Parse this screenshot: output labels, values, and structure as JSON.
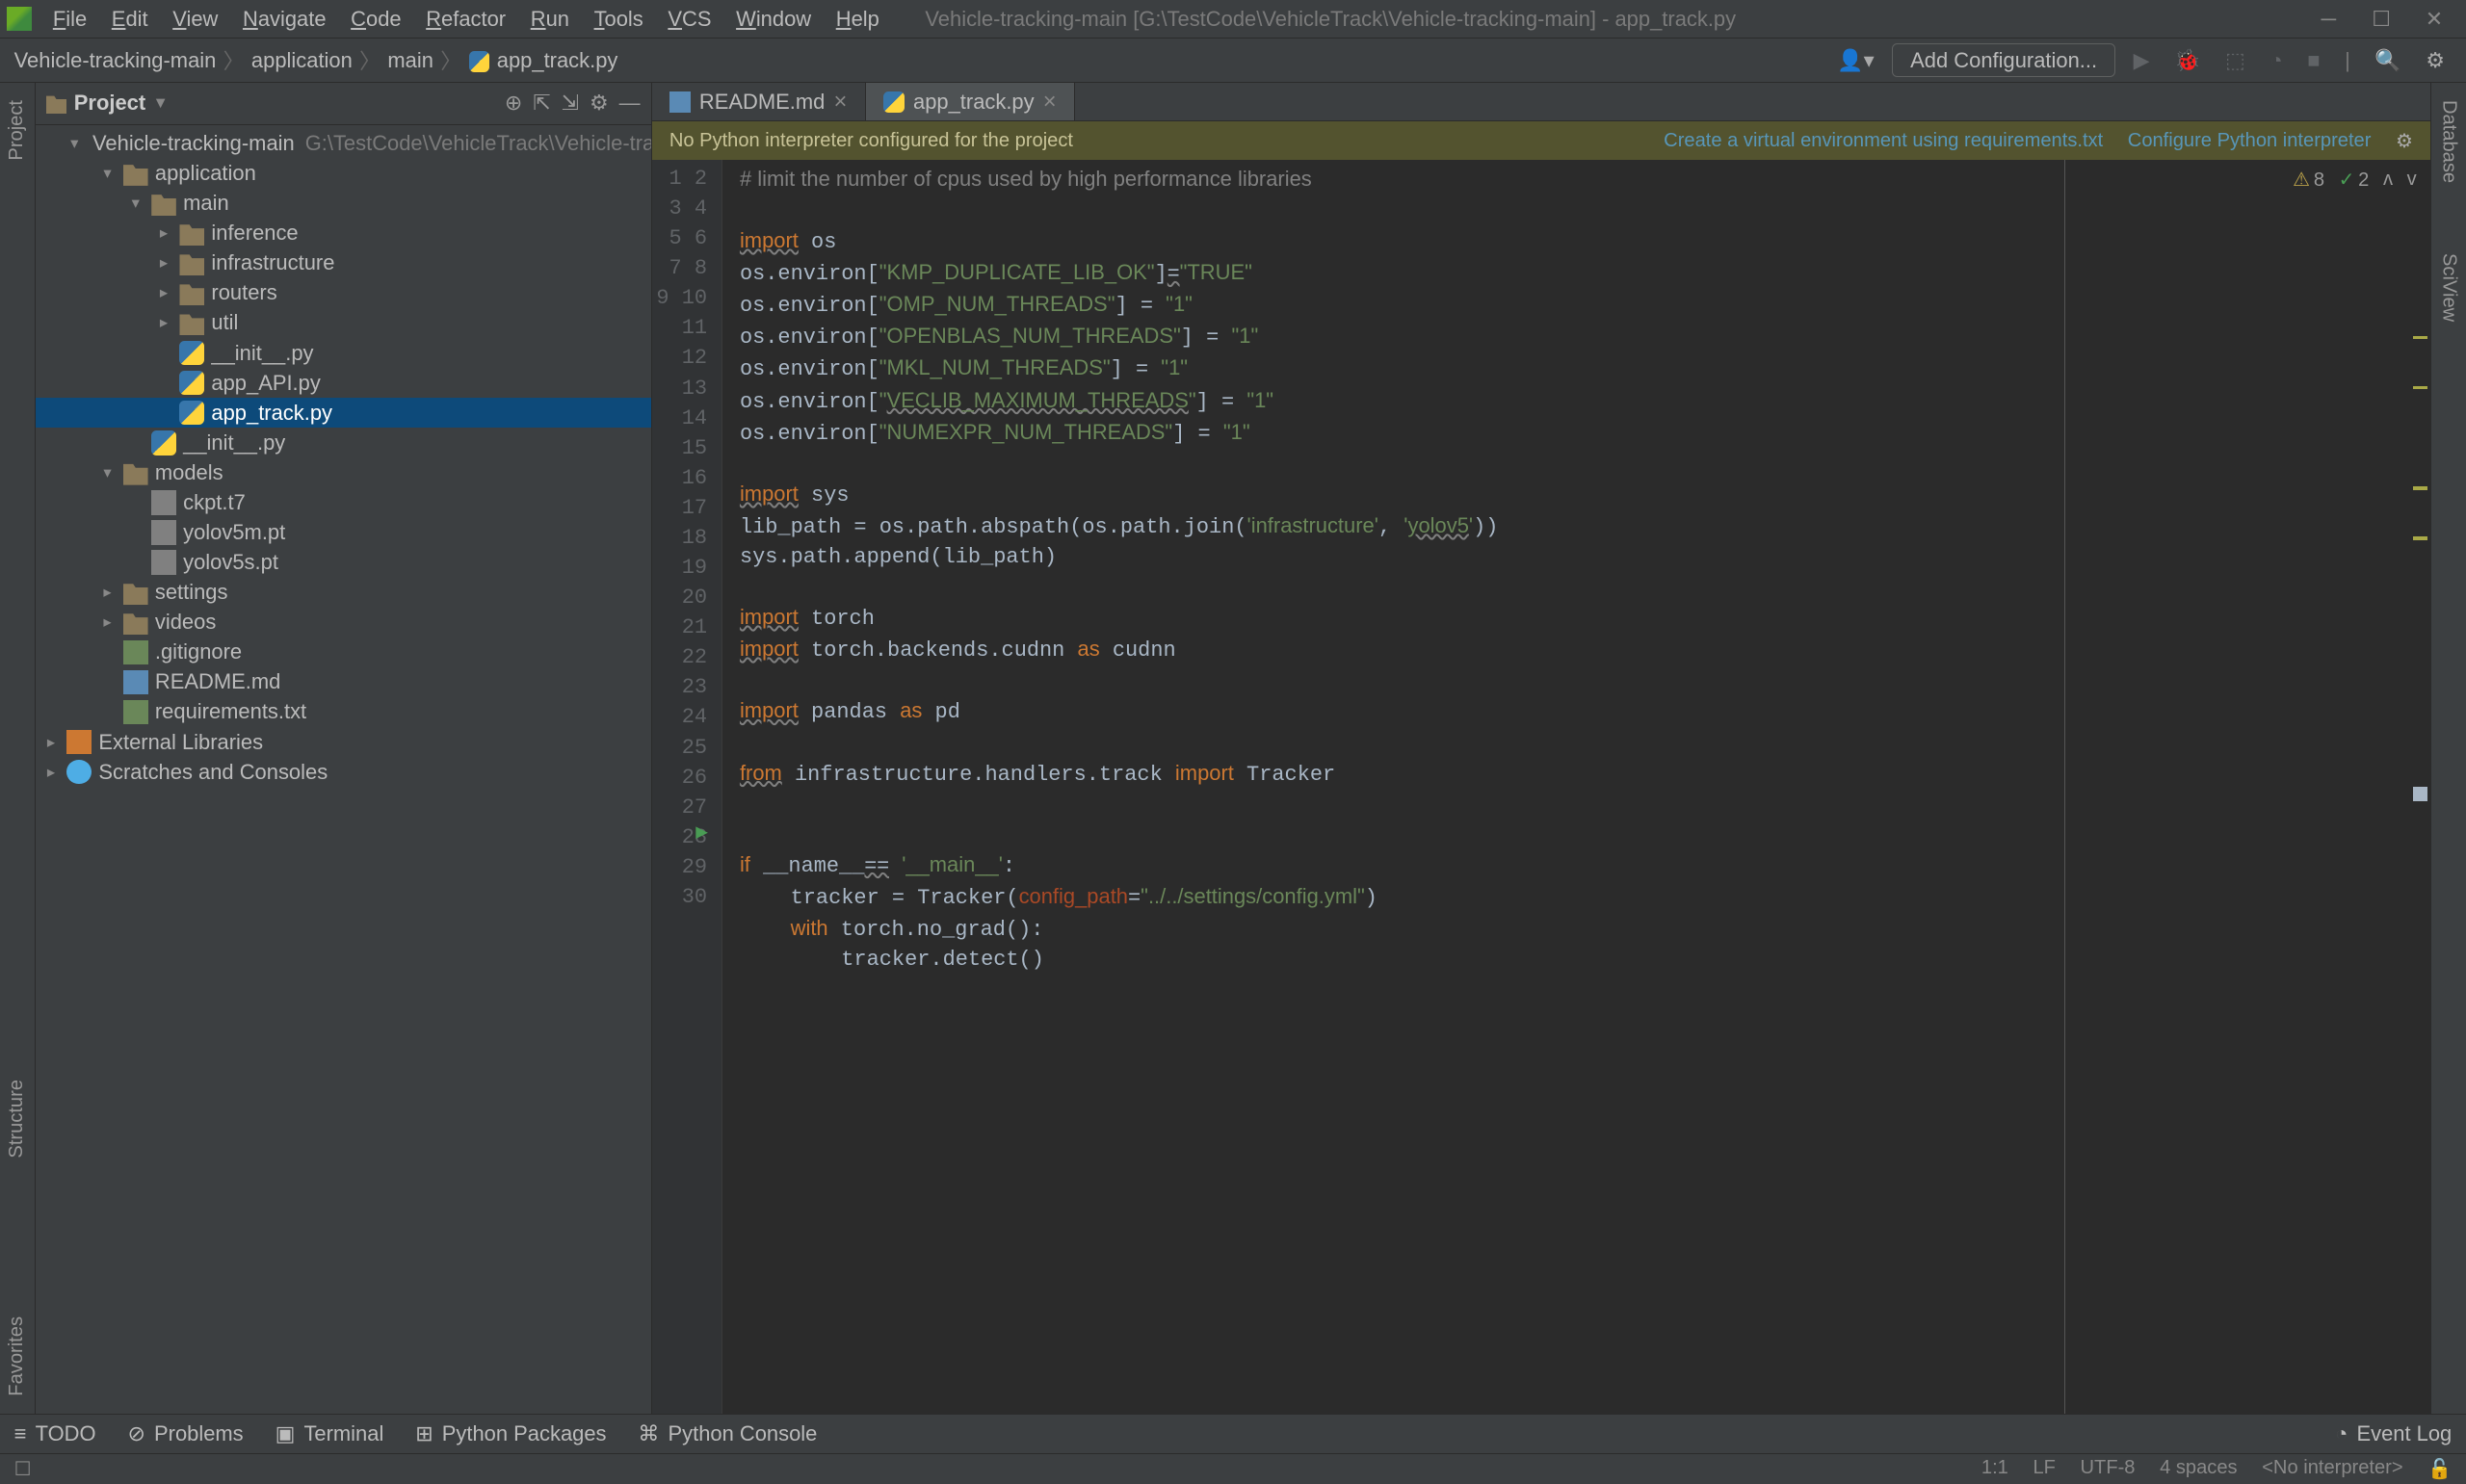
{
  "window": {
    "title": "Vehicle-tracking-main [G:\\TestCode\\VehicleTrack\\Vehicle-tracking-main] - app_track.py"
  },
  "menu": [
    "File",
    "Edit",
    "View",
    "Navigate",
    "Code",
    "Refactor",
    "Run",
    "Tools",
    "VCS",
    "Window",
    "Help"
  ],
  "breadcrumbs": [
    "Vehicle-tracking-main",
    "application",
    "main",
    "app_track.py"
  ],
  "toolbar": {
    "add_configuration": "Add Configuration..."
  },
  "sidebar": {
    "title": "Project",
    "root": {
      "name": "Vehicle-tracking-main",
      "path": "G:\\TestCode\\VehicleTrack\\Vehicle-tracking-main"
    },
    "tree": [
      {
        "depth": 0,
        "arrow": "▾",
        "icon": "folder",
        "label": "Vehicle-tracking-main",
        "path": "G:\\TestCode\\VehicleTrack\\Vehicle-tracking-main"
      },
      {
        "depth": 1,
        "arrow": "▾",
        "icon": "folder",
        "label": "application"
      },
      {
        "depth": 2,
        "arrow": "▾",
        "icon": "folder",
        "label": "main"
      },
      {
        "depth": 3,
        "arrow": "▸",
        "icon": "folder",
        "label": "inference"
      },
      {
        "depth": 3,
        "arrow": "▸",
        "icon": "folder",
        "label": "infrastructure"
      },
      {
        "depth": 3,
        "arrow": "▸",
        "icon": "folder",
        "label": "routers"
      },
      {
        "depth": 3,
        "arrow": "▸",
        "icon": "folder",
        "label": "util"
      },
      {
        "depth": 3,
        "arrow": "",
        "icon": "py",
        "label": "__init__.py"
      },
      {
        "depth": 3,
        "arrow": "",
        "icon": "py",
        "label": "app_API.py"
      },
      {
        "depth": 3,
        "arrow": "",
        "icon": "py",
        "label": "app_track.py",
        "selected": true
      },
      {
        "depth": 2,
        "arrow": "",
        "icon": "py",
        "label": "__init__.py"
      },
      {
        "depth": 1,
        "arrow": "▾",
        "icon": "folder",
        "label": "models"
      },
      {
        "depth": 2,
        "arrow": "",
        "icon": "file",
        "label": "ckpt.t7"
      },
      {
        "depth": 2,
        "arrow": "",
        "icon": "file",
        "label": "yolov5m.pt"
      },
      {
        "depth": 2,
        "arrow": "",
        "icon": "file",
        "label": "yolov5s.pt"
      },
      {
        "depth": 1,
        "arrow": "▸",
        "icon": "folder",
        "label": "settings"
      },
      {
        "depth": 1,
        "arrow": "▸",
        "icon": "folder",
        "label": "videos"
      },
      {
        "depth": 1,
        "arrow": "",
        "icon": "txt",
        "label": ".gitignore"
      },
      {
        "depth": 1,
        "arrow": "",
        "icon": "md",
        "label": "README.md"
      },
      {
        "depth": 1,
        "arrow": "",
        "icon": "txt",
        "label": "requirements.txt"
      },
      {
        "depth": 0,
        "arrow": "▸",
        "icon": "lib",
        "label": "External Libraries",
        "top": true
      },
      {
        "depth": 0,
        "arrow": "▸",
        "icon": "scratch",
        "label": "Scratches and Consoles",
        "top": true
      }
    ]
  },
  "tabs": [
    {
      "icon": "md",
      "label": "README.md",
      "active": false
    },
    {
      "icon": "py",
      "label": "app_track.py",
      "active": true
    }
  ],
  "banner": {
    "text": "No Python interpreter configured for the project",
    "link1": "Create a virtual environment using requirements.txt",
    "link2": "Configure Python interpreter"
  },
  "inspections": {
    "warnings": "8",
    "passes": "2"
  },
  "code_lines": 30,
  "bottom_tabs": [
    "TODO",
    "Problems",
    "Terminal",
    "Python Packages",
    "Python Console"
  ],
  "event_log": "Event Log",
  "status": {
    "pos": "1:1",
    "le": "LF",
    "enc": "UTF-8",
    "indent": "4 spaces",
    "interp": "<No interpreter>"
  },
  "left_tools": [
    "Project",
    "Structure",
    "Favorites"
  ],
  "right_tools": [
    "Database",
    "SciView"
  ]
}
